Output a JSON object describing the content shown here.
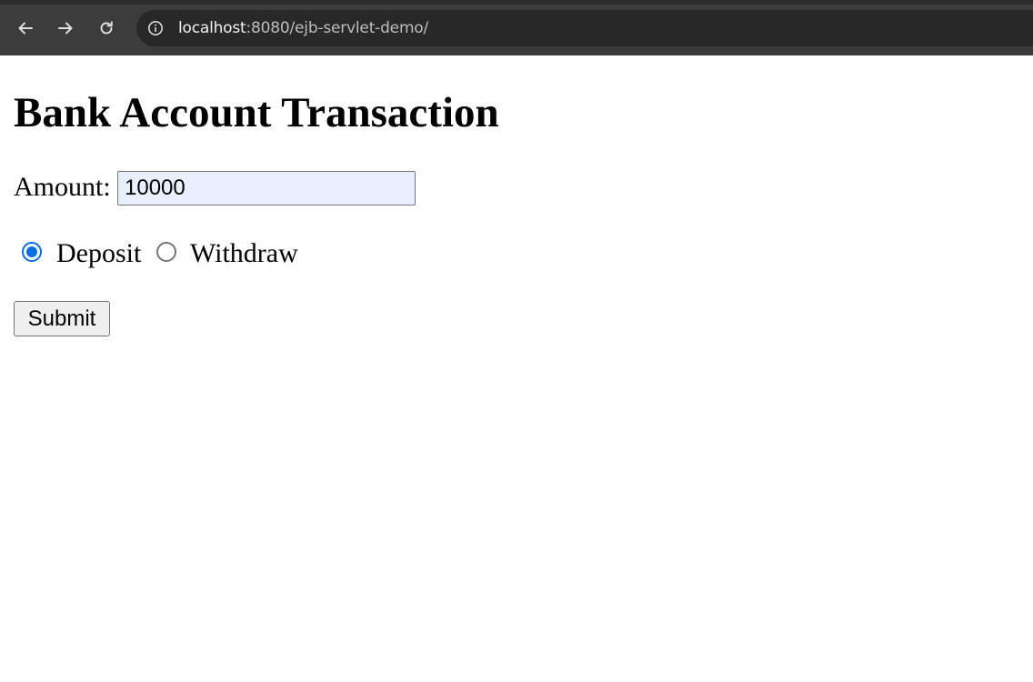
{
  "browser": {
    "url_host": "localhost",
    "url_rest": ":8080/ejb-servlet-demo/",
    "icons": {
      "back": "back-arrow-icon",
      "forward": "forward-arrow-icon",
      "reload": "reload-icon",
      "site_info": "info-icon"
    }
  },
  "page": {
    "title": "Bank Account Transaction",
    "amount_label": "Amount:",
    "amount_value": "10000",
    "radio_deposit_label": "Deposit",
    "radio_withdraw_label": "Withdraw",
    "selected_option": "Deposit",
    "submit_label": "Submit"
  },
  "colors": {
    "toolbar_bg": "#3c3c3c",
    "address_bg": "#282828",
    "radio_accent": "#0b6ee0",
    "input_autofill_bg": "#e8f0fe"
  }
}
